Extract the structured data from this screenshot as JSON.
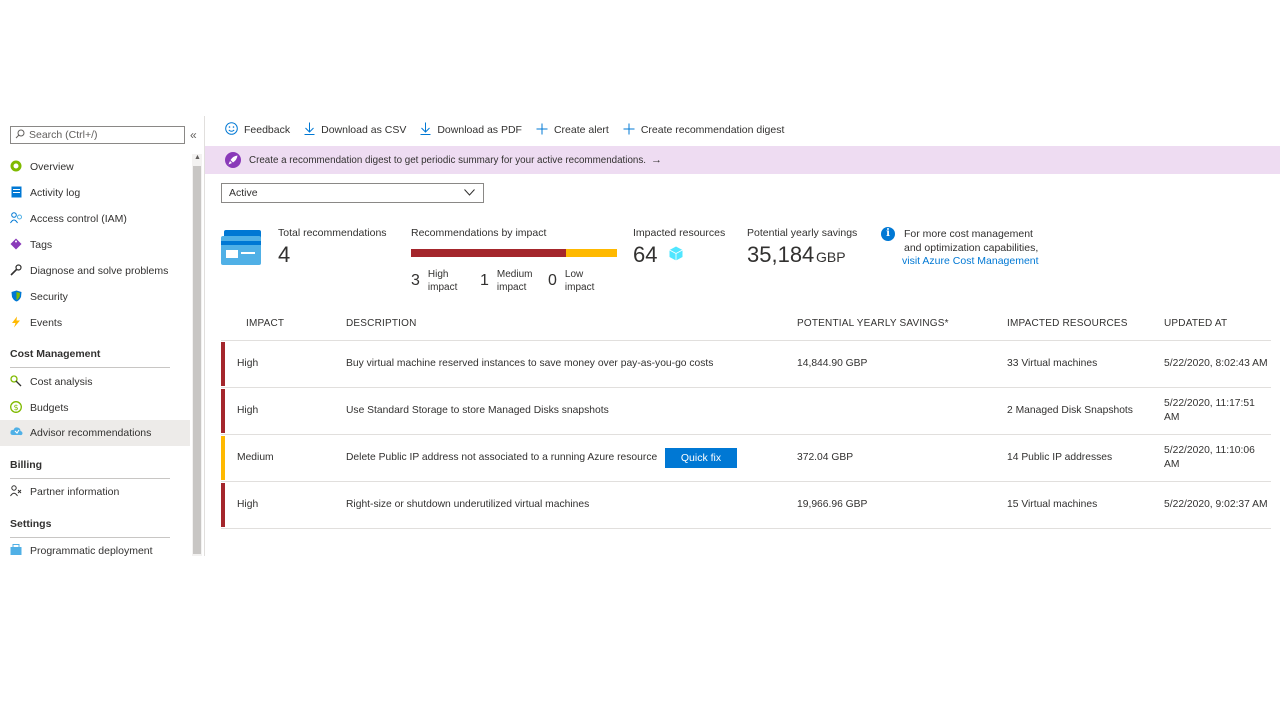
{
  "sidebar": {
    "search_placeholder": "Search (Ctrl+/)",
    "collapse_glyph": "«",
    "items": [
      {
        "label": "Overview",
        "icon": "overview-icon"
      },
      {
        "label": "Activity log",
        "icon": "activity-log-icon"
      },
      {
        "label": "Access control (IAM)",
        "icon": "people-icon"
      },
      {
        "label": "Tags",
        "icon": "tag-icon"
      },
      {
        "label": "Diagnose and solve problems",
        "icon": "wrench-icon"
      },
      {
        "label": "Security",
        "icon": "shield-icon"
      },
      {
        "label": "Events",
        "icon": "lightning-icon"
      }
    ],
    "sections": [
      {
        "title": "Cost Management",
        "items": [
          {
            "label": "Cost analysis",
            "icon": "cost-analysis-icon"
          },
          {
            "label": "Budgets",
            "icon": "budget-icon"
          },
          {
            "label": "Advisor recommendations",
            "icon": "advisor-icon",
            "active": true
          }
        ]
      },
      {
        "title": "Billing",
        "items": [
          {
            "label": "Partner information",
            "icon": "partner-icon"
          }
        ]
      },
      {
        "title": "Settings",
        "items": [
          {
            "label": "Programmatic deployment",
            "icon": "deployment-icon"
          }
        ]
      }
    ]
  },
  "toolbar": {
    "feedback": "Feedback",
    "download_csv": "Download as CSV",
    "download_pdf": "Download as PDF",
    "create_alert": "Create alert",
    "create_digest": "Create recommendation digest"
  },
  "banner": {
    "text": "Create a recommendation digest to get periodic summary for your active recommendations.",
    "arrow": "→"
  },
  "filter": {
    "value": "Active"
  },
  "stats": {
    "total_label": "Total recommendations",
    "total_value": "4",
    "by_impact_label": "Recommendations by impact",
    "high_count": "3",
    "high_label_1": "High",
    "high_label_2": "impact",
    "medium_count": "1",
    "medium_label_1": "Medium",
    "medium_label_2": "impact",
    "low_count": "0",
    "low_label_1": "Low",
    "low_label_2": "impact",
    "impacted_label": "Impacted resources",
    "impacted_value": "64",
    "savings_label": "Potential yearly savings",
    "savings_value": "35,184",
    "savings_unit": "GBP",
    "info_line1": "For more cost management",
    "info_line2": "and optimization capabilities,",
    "info_link": "visit Azure Cost Management"
  },
  "colors": {
    "high": "#a4262c",
    "medium": "#ffb900",
    "accent": "#0078d4",
    "banner": "#eedcf2"
  },
  "table": {
    "headers": {
      "impact": "IMPACT",
      "description": "DESCRIPTION",
      "savings": "POTENTIAL YEARLY SAVINGS*",
      "resources": "IMPACTED RESOURCES",
      "updated": "UPDATED AT"
    },
    "quick_fix_label": "Quick fix",
    "rows": [
      {
        "impact": "High",
        "description": "Buy virtual machine reserved instances to save money over pay-as-you-go costs",
        "savings": "14,844.90 GBP",
        "resources": "33 Virtual machines",
        "updated": "5/22/2020, 8:02:43 AM"
      },
      {
        "impact": "High",
        "description": "Use Standard Storage to store Managed Disks snapshots",
        "savings": "",
        "resources": "2 Managed Disk Snapshots",
        "updated": "5/22/2020, 11:17:51 AM"
      },
      {
        "impact": "Medium",
        "description": "Delete Public IP address not associated to a running Azure resource",
        "savings": "372.04 GBP",
        "resources": "14 Public IP addresses",
        "updated": "5/22/2020, 11:10:06 AM"
      },
      {
        "impact": "High",
        "description": "Right-size or shutdown underutilized virtual machines",
        "savings": "19,966.96 GBP",
        "resources": "15 Virtual machines",
        "updated": "5/22/2020, 9:02:37 AM"
      }
    ]
  }
}
